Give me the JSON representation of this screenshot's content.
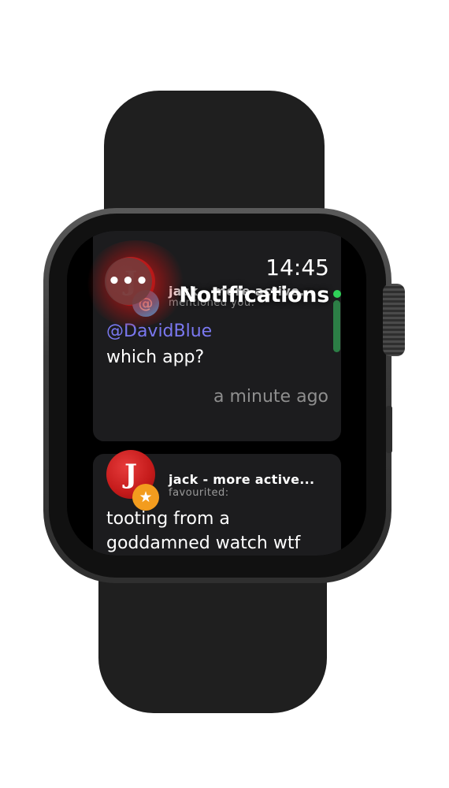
{
  "status": {
    "time": "14:45"
  },
  "nav": {
    "title": "Notifications",
    "more_glyph": "•••"
  },
  "notifications": [
    {
      "username": "jack - more active...",
      "action": "mentioned you:",
      "badge_glyph": "@",
      "badge_color": "#3ea7e6",
      "mention": "@DavidBlue",
      "text": "which app?",
      "time": "a minute ago"
    },
    {
      "username": "jack - more active...",
      "action": "favourited:",
      "badge_glyph": "★",
      "badge_color": "#f39c1e",
      "text_line1": "tooting from a",
      "text_line2": "goddamned watch wtf"
    }
  ],
  "avatar_letter": "J",
  "colors": {
    "accent": "#7a78f0",
    "scroll_indicator": "#2fd158"
  }
}
